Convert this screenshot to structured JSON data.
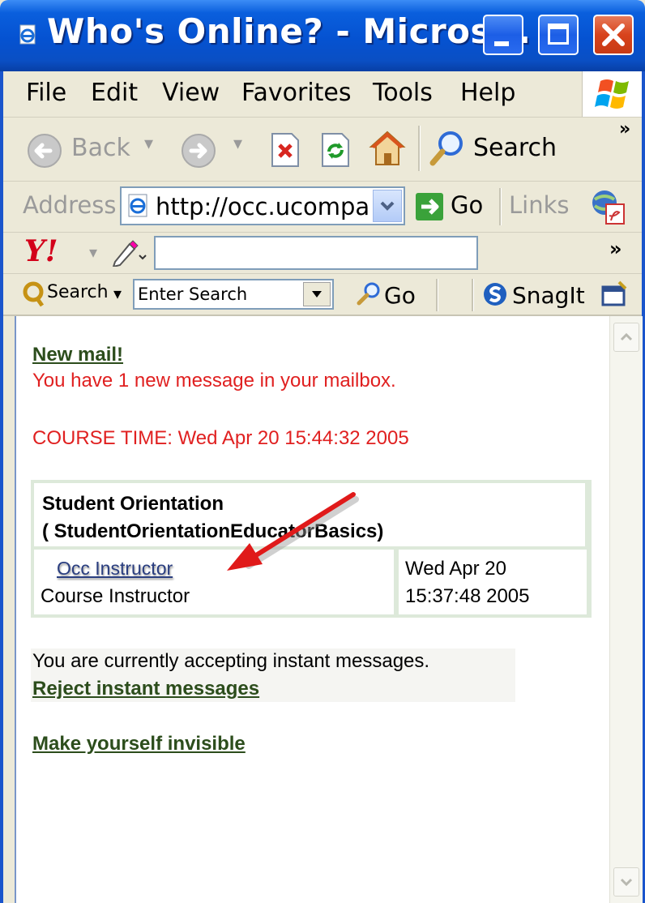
{
  "window": {
    "title": "Who's Online? - Micros...",
    "buttons": {
      "minimize": "minimize",
      "maximize": "maximize",
      "close": "close"
    }
  },
  "menubar": [
    "File",
    "Edit",
    "View",
    "Favorites",
    "Tools",
    "Help"
  ],
  "toolbar": {
    "back": "Back",
    "search": "Search",
    "overflow": "»"
  },
  "address": {
    "label": "Address",
    "url": "http://occ.ucompa",
    "go": "Go",
    "links": "Links"
  },
  "yahoo": {
    "logo": "Y!",
    "overflow": "»",
    "input_value": ""
  },
  "searchbar": {
    "search_label": "Search",
    "placeholder": "Enter Search",
    "go": "Go",
    "snagit": "SnagIt"
  },
  "content": {
    "new_mail_link": "New mail!",
    "new_mail_text": "You have 1 new message in your mailbox.",
    "course_time": "COURSE TIME: Wed Apr 20 15:44:32 2005",
    "course": {
      "name": "Student Orientation",
      "code": "( StudentOrientationEducatorBasics)",
      "instructor_link": "Occ Instructor",
      "role": "Course Instructor",
      "date_line1": "Wed Apr 20",
      "date_line2": "15:37:48 2005"
    },
    "im_status": "You are currently accepting instant messages.",
    "reject_link": "Reject instant messages",
    "invisible_link": "Make yourself invisible"
  },
  "colors": {
    "titlebar": "#0552d1",
    "link": "#2c4d1c",
    "alert": "#e02020",
    "arrow": "#e01a1a",
    "course_border": "#dde9da"
  }
}
